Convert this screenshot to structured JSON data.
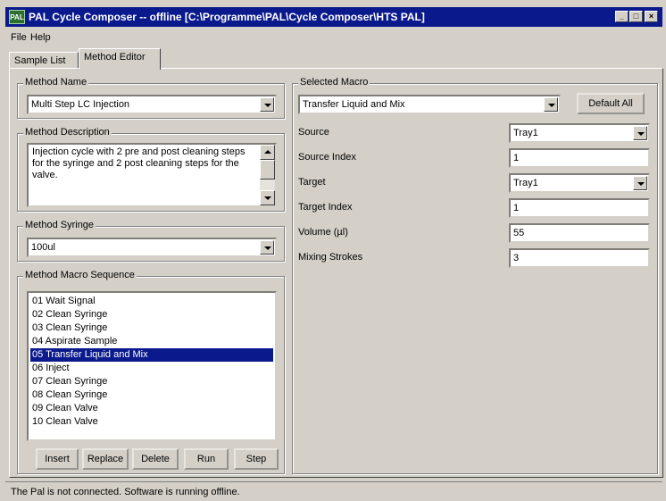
{
  "window": {
    "title": "PAL Cycle Composer -- offline   [C:\\Programme\\PAL\\Cycle Composer\\HTS PAL]",
    "icon_label": "PAL",
    "icon_name": "pal-app-icon"
  },
  "menu": {
    "file": "File",
    "help": "Help"
  },
  "tabs": {
    "sample_list": "Sample List",
    "method_editor": "Method Editor",
    "active": "Method Editor"
  },
  "method_name": {
    "legend": "Method Name",
    "value": "Multi Step LC Injection"
  },
  "method_description": {
    "legend": "Method Description",
    "text": "Injection cycle with 2 pre and post cleaning steps for the syringe and 2 post cleaning steps for the valve."
  },
  "method_syringe": {
    "legend": "Method Syringe",
    "value": "100ul"
  },
  "macro_sequence": {
    "legend": "Method Macro Sequence",
    "items": [
      "01 Wait Signal",
      "02 Clean Syringe",
      "03 Clean Syringe",
      "04 Aspirate Sample",
      "05 Transfer Liquid and Mix",
      "06 Inject",
      "07 Clean Syringe",
      "08 Clean Syringe",
      "09 Clean Valve",
      "10 Clean Valve"
    ],
    "selected_index": 4,
    "buttons": {
      "insert": "Insert",
      "replace": "Replace",
      "delete": "Delete",
      "run": "Run",
      "step": "Step"
    }
  },
  "selected_macro": {
    "legend": "Selected Macro",
    "value": "Transfer Liquid and Mix",
    "default_all": "Default All",
    "params": {
      "source_label": "Source",
      "source_value": "Tray1",
      "source_index_label": "Source Index",
      "source_index_value": "1",
      "target_label": "Target",
      "target_value": "Tray1",
      "target_index_label": "Target Index",
      "target_index_value": "1",
      "volume_label": "Volume  (µl)",
      "volume_value": "55",
      "mixing_strokes_label": "Mixing Strokes",
      "mixing_strokes_value": "3"
    }
  },
  "status_bar": {
    "text": "The Pal is not connected. Software is running offline."
  },
  "colors": {
    "titlebar": "#0a1a8c",
    "face": "#d4d0c8",
    "selection": "#0a1a8c"
  }
}
